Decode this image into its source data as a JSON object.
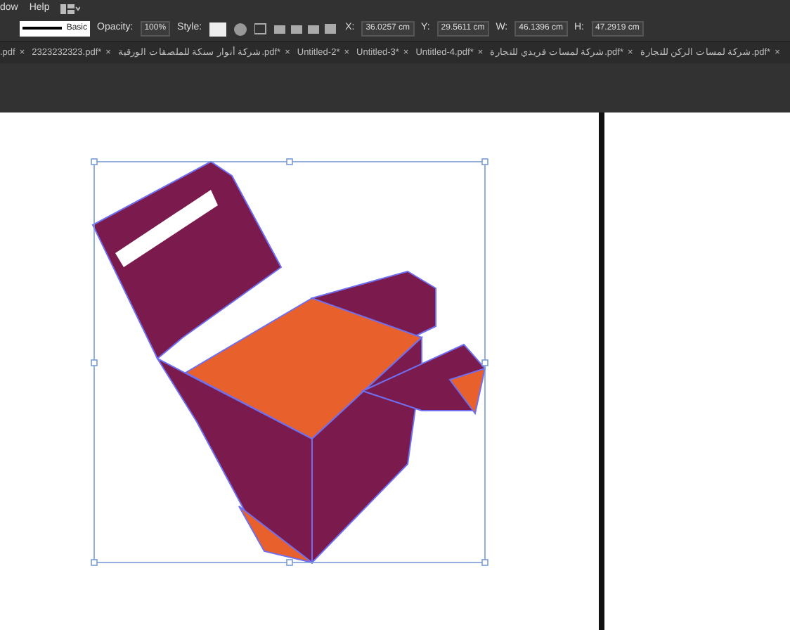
{
  "menu_bar": {
    "items": [
      "dow",
      "Help"
    ]
  },
  "control_bar": {
    "stroke_style": "Basic",
    "opacity_label": "Opacity:",
    "opacity_value": "100%",
    "style_label": "Style:",
    "fields": [
      {
        "label": "X:",
        "value": "36.0257 cm"
      },
      {
        "label": "Y:",
        "value": "29.5611 cm"
      },
      {
        "label": "W:",
        "value": "46.1396 cm"
      },
      {
        "label": "H:",
        "value": "47.2919 cm"
      }
    ]
  },
  "tabs": [
    {
      "label": ".pdf",
      "close": "×"
    },
    {
      "label": "2323232323.pdf*",
      "close": "×"
    },
    {
      "label": "شركة أنوار سنكة للملصقات الورقية.pdf*",
      "close": "×"
    },
    {
      "label": "Untitled-2*",
      "close": "×"
    },
    {
      "label": "Untitled-3*",
      "close": "×"
    },
    {
      "label": "Untitled-4.pdf*",
      "close": "×"
    },
    {
      "label": "شركة لمسات فريدي للتجارة.pdf*",
      "close": "×"
    },
    {
      "label": "شركة لمسات الركن للتجارة.pdf*",
      "close": "×"
    }
  ],
  "canvas": {
    "object_selected": true
  }
}
